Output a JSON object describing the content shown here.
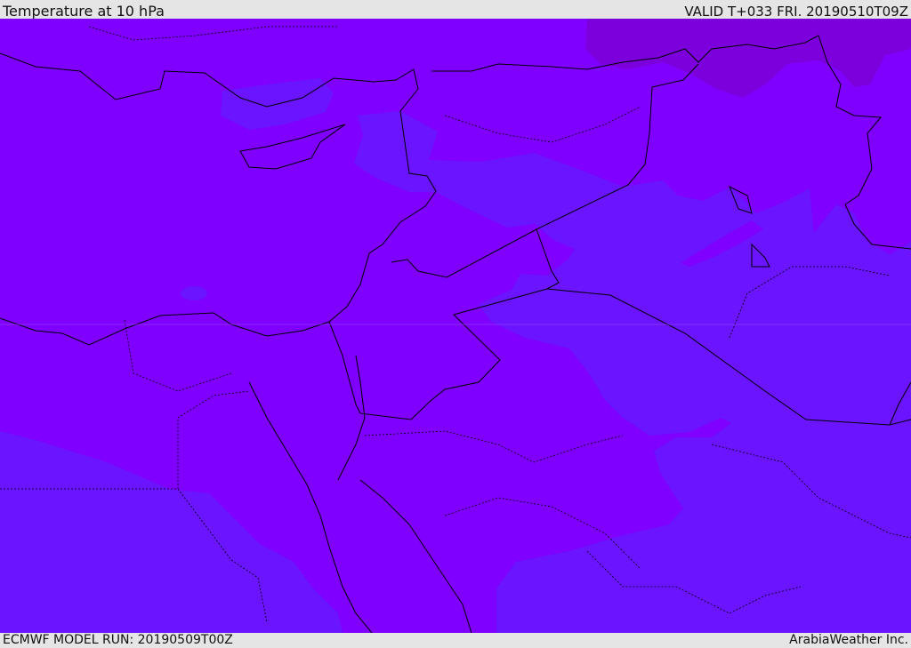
{
  "header": {
    "title": "Temperature at 10 hPa",
    "valid_time": "VALID T+033 FRI. 20190510T09Z"
  },
  "footer": {
    "model_run": "ECMWF MODEL RUN: 20190509T00Z",
    "credit": "ArabiaWeather Inc."
  },
  "colors": {
    "base": "#7f00ff",
    "cooler": "#6a14ff",
    "warmer": "#7c00dc",
    "borders": "#000000",
    "frame": "#e5e5e5"
  }
}
